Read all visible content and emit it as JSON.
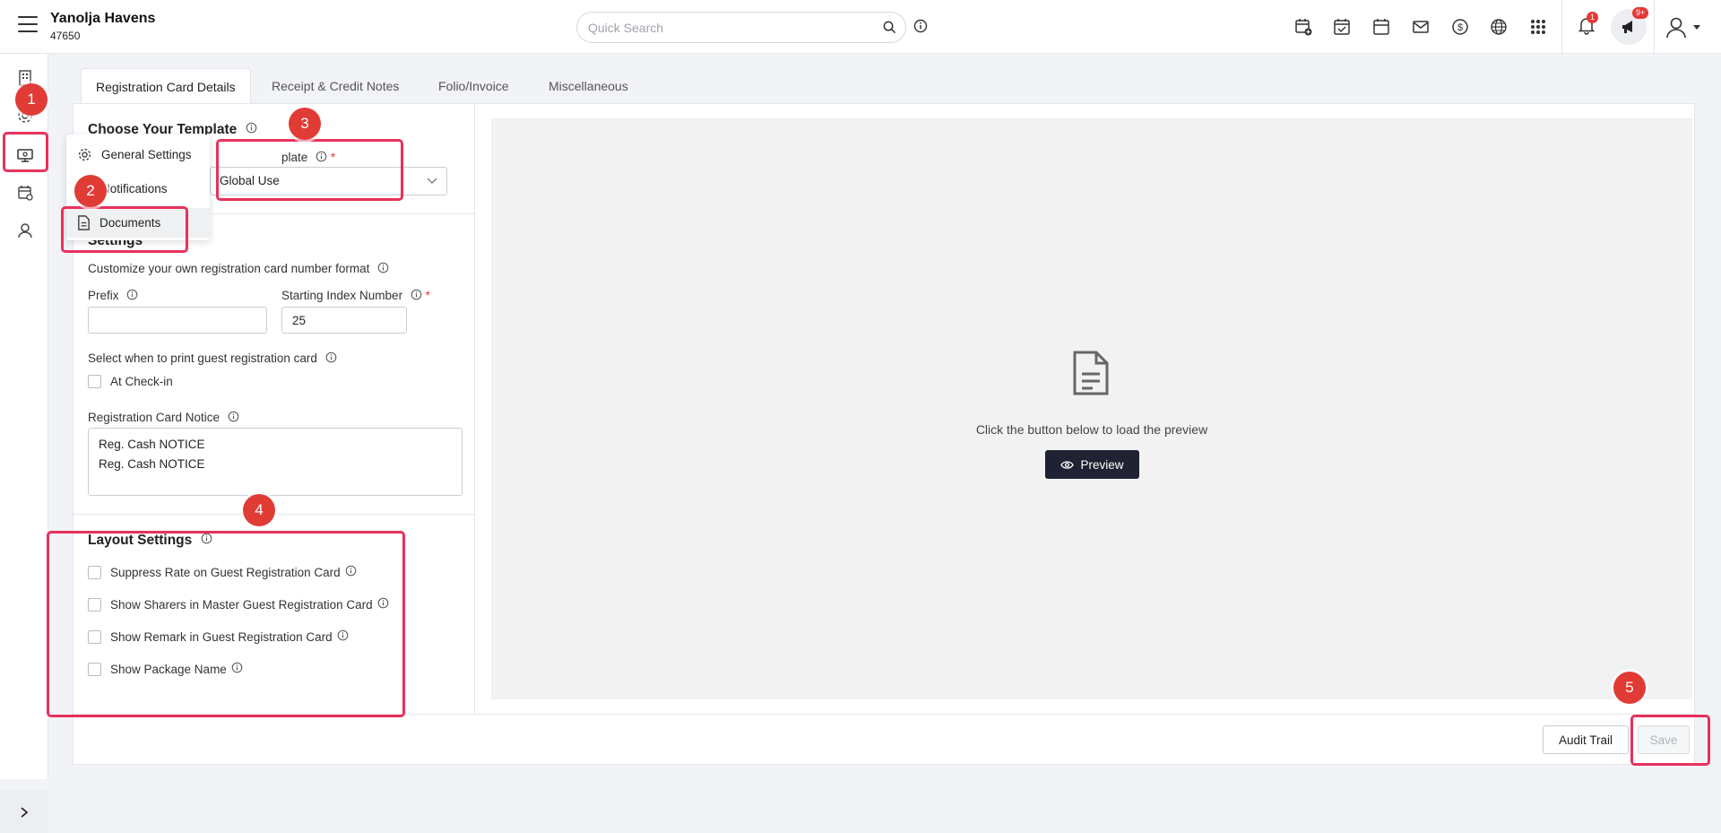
{
  "header": {
    "property_name": "Yanolja Havens",
    "property_id": "47650",
    "search_placeholder": "Quick Search",
    "notifications_count": "1",
    "announcements_count": "9+"
  },
  "tabs": [
    {
      "label": "Registration Card Details",
      "active": true
    },
    {
      "label": "Receipt & Credit Notes",
      "active": false
    },
    {
      "label": "Folio/Invoice",
      "active": false
    },
    {
      "label": "Miscellaneous",
      "active": false
    }
  ],
  "template_section": {
    "title": "Choose Your Template",
    "field_label_partial": "plate",
    "selected_value": "Global Use"
  },
  "settings_section": {
    "title": "Settings",
    "number_format_label": "Customize your own registration card number format",
    "prefix_label": "Prefix",
    "prefix_value": "",
    "starting_index_label": "Starting Index Number",
    "starting_index_value": "25",
    "print_when_label": "Select when to print guest registration card",
    "print_at_checkin_label": "At Check-in",
    "notice_label": "Registration Card Notice",
    "notice_lines": [
      "Reg. Cash NOTICE",
      "Reg. Cash NOTICE"
    ]
  },
  "layout_section": {
    "title": "Layout Settings",
    "options": [
      "Suppress Rate on Guest Registration Card",
      "Show Sharers in Master Guest Registration Card",
      "Show Remark in Guest Registration Card",
      "Show Package Name"
    ]
  },
  "preview": {
    "message": "Click the button below to load the preview",
    "button_label": "Preview"
  },
  "footer": {
    "audit_label": "Audit Trail",
    "save_label": "Save"
  },
  "popup_menu": {
    "items": [
      "General Settings",
      "Notifications",
      "Documents"
    ],
    "selected": "Documents"
  },
  "annotations": [
    "1",
    "2",
    "3",
    "4",
    "5"
  ],
  "colors": {
    "highlight": "#e8315b",
    "marker": "#e13b35",
    "preview_button": "#1e2232",
    "required": "#e53935"
  }
}
